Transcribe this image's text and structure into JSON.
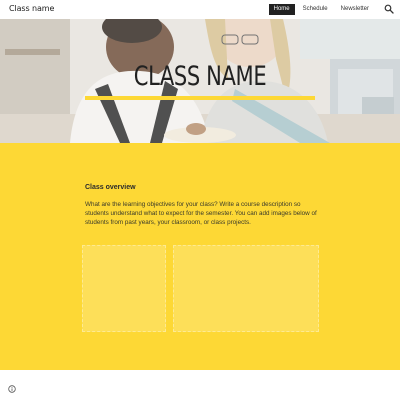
{
  "site": {
    "title": "Class name"
  },
  "nav": {
    "items": [
      {
        "label": "Home",
        "active": true
      },
      {
        "label": "Schedule",
        "active": false
      },
      {
        "label": "Newsletter",
        "active": false
      }
    ]
  },
  "hero": {
    "title": "CLASS NAME"
  },
  "overview": {
    "heading": "Class overview",
    "body": "What are the learning objectives for your class? Write a course description so students understand what to expect for the semester. You can add images below of students from past years, your classroom, or class projects."
  },
  "colors": {
    "accent": "#fdd835",
    "nav_active": "#212121",
    "text": "#212121"
  },
  "icons": {
    "search": "search-icon",
    "info": "info-icon"
  }
}
